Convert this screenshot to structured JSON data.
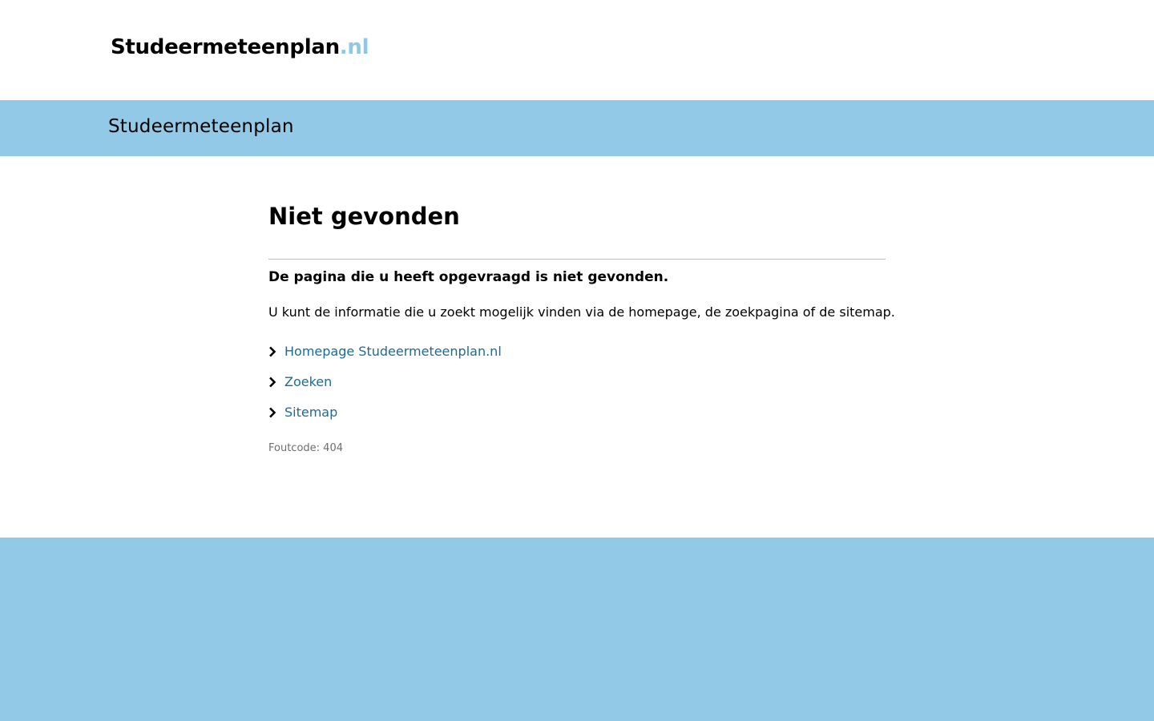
{
  "header": {
    "logo_name": "Studeermeteenplan",
    "logo_tld": ".nl"
  },
  "banner": {
    "title": "Studeermeteenplan"
  },
  "main": {
    "title": "Niet gevonden",
    "lead": "De pagina die u heeft opgevraagd is niet gevonden.",
    "intro": "U kunt de informatie die u zoekt mogelijk vinden via de homepage, de zoekpagina of de sitemap.",
    "links": [
      {
        "label": "Homepage Studeermeteenplan.nl"
      },
      {
        "label": "Zoeken"
      },
      {
        "label": "Sitemap"
      }
    ],
    "error_code": "Foutcode: 404"
  },
  "colors": {
    "accent": "#92c9e6",
    "link": "#1a6b9a",
    "muted": "#6e6e6e"
  },
  "icons": {
    "link_bullet": "chevron-right-icon"
  }
}
